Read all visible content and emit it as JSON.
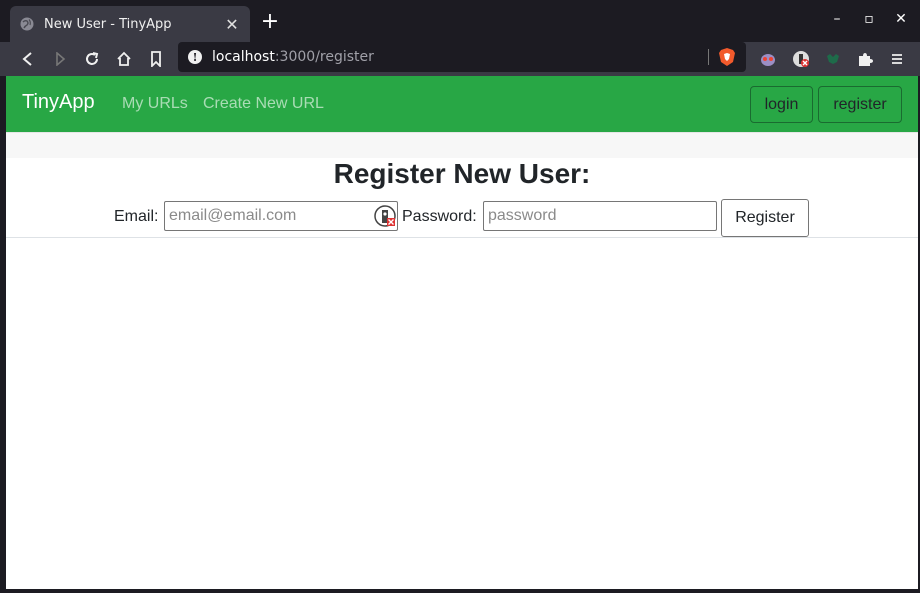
{
  "browser": {
    "tab_title": "New User - TinyApp",
    "url_host": "localhost",
    "url_path": ":3000/register"
  },
  "icons": {
    "tab": "globe-icon",
    "toolbar": [
      "back-icon",
      "forward-icon",
      "reload-icon",
      "home-icon",
      "bookmark-icon",
      "site-info-icon",
      "brave-shields-icon"
    ],
    "extensions": [
      "ghost-extension-icon",
      "privacy-extension-icon",
      "green-extension-icon",
      "puzzle-icon",
      "menu-icon"
    ]
  },
  "navbar": {
    "brand": "TinyApp",
    "links": [
      "My URLs",
      "Create New URL"
    ],
    "login_label": "login",
    "register_label": "register",
    "color": "#28a745"
  },
  "form": {
    "heading": "Register New User:",
    "email_label": "Email:",
    "email_placeholder": "email@email.com",
    "password_label": "Password:",
    "password_placeholder": "password",
    "submit_label": "Register"
  }
}
